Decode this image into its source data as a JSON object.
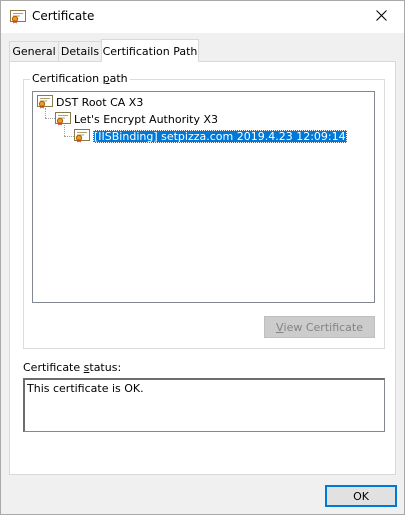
{
  "window": {
    "title": "Certificate",
    "icon": "certificate-icon",
    "close_icon": "close-icon"
  },
  "tabs": [
    {
      "label": "General",
      "active": false
    },
    {
      "label": "Details",
      "active": false
    },
    {
      "label": "Certification Path",
      "active": true
    }
  ],
  "path_group": {
    "label_prefix": "Certification ",
    "label_accel": "p",
    "label_suffix": "ath",
    "nodes": [
      {
        "label": "DST Root CA X3",
        "selected": false,
        "icon": "certificate-icon"
      },
      {
        "label": "Let's Encrypt Authority X3",
        "selected": false,
        "icon": "certificate-icon"
      },
      {
        "label": "[IISBinding] setpizza.com 2019.4.23 12:09:14",
        "selected": true,
        "icon": "certificate-icon"
      }
    ],
    "view_button_accel": "V",
    "view_button_rest": "iew Certificate"
  },
  "status": {
    "label_prefix": "Certificate ",
    "label_accel": "s",
    "label_suffix": "tatus:",
    "text": "This certificate is OK."
  },
  "ok_button": "OK",
  "colors": {
    "selection": "#0078d7",
    "dialog_bg": "#f0f0f0"
  }
}
